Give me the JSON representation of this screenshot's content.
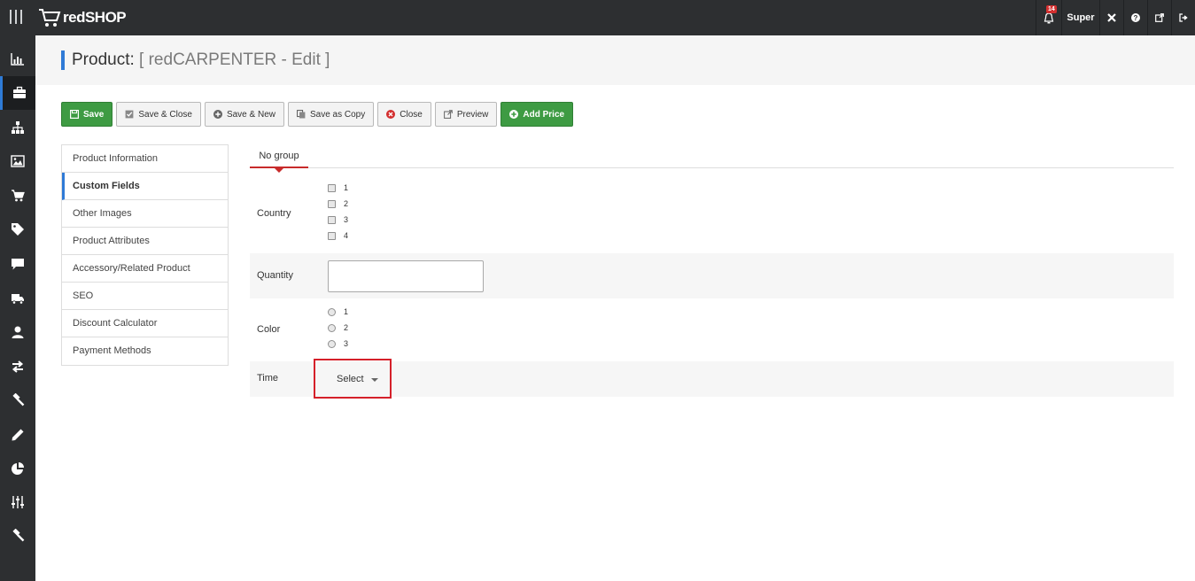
{
  "app": {
    "logo_text": "redSHOP"
  },
  "topnav": {
    "notifications_count": "14",
    "user_label": "Super"
  },
  "page": {
    "title_prefix": "Product:",
    "title_suffix": "[ redCARPENTER - Edit ]"
  },
  "toolbar": {
    "save": "Save",
    "save_close": "Save & Close",
    "save_new": "Save & New",
    "save_copy": "Save as Copy",
    "close": "Close",
    "preview": "Preview",
    "add_price": "Add Price"
  },
  "tabs": [
    "Product Information",
    "Custom Fields",
    "Other Images",
    "Product Attributes",
    "Accessory/Related Product",
    "SEO",
    "Discount Calculator",
    "Payment Methods"
  ],
  "group_tab": "No group",
  "fields": {
    "country": {
      "label": "Country",
      "options": [
        "1",
        "2",
        "3",
        "4"
      ]
    },
    "quantity": {
      "label": "Quantity",
      "value": ""
    },
    "color": {
      "label": "Color",
      "options": [
        "1",
        "2",
        "3"
      ]
    },
    "time": {
      "label": "Time",
      "selected": "Select"
    }
  },
  "colors": {
    "topbar": "#2d2f31",
    "accent_blue": "#2f7ad6",
    "success": "#3e9b43",
    "danger": "#d5202a"
  }
}
